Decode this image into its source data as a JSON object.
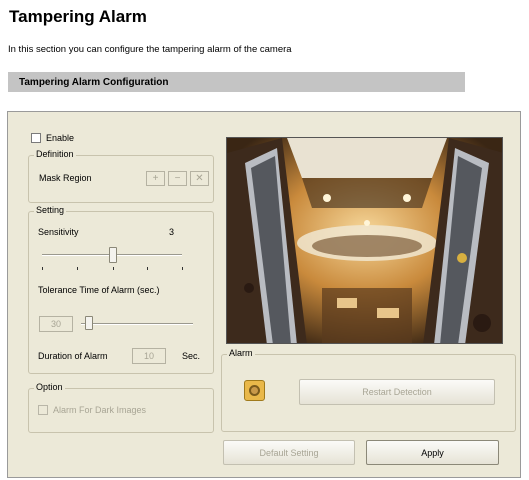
{
  "page": {
    "title": "Tampering Alarm",
    "description": "In this section you can configure the tampering alarm of the camera",
    "section_header": "Tampering Alarm Configuration"
  },
  "enable": {
    "label": "Enable",
    "checked": false
  },
  "definition": {
    "legend": "Definition",
    "mask_region_label": "Mask Region",
    "tools": [
      "add-mask-icon",
      "remove-mask-icon",
      "clear-mask-icon"
    ]
  },
  "setting": {
    "legend": "Setting",
    "sensitivity_label": "Sensitivity",
    "sensitivity_value": "3",
    "tolerance_label": "Tolerance Time of Alarm (sec.)",
    "tolerance_value": "30",
    "duration_label": "Duration of Alarm",
    "duration_value": "10",
    "duration_unit": "Sec."
  },
  "option": {
    "legend": "Option",
    "dark_images_label": "Alarm For Dark Images",
    "dark_images_checked": false
  },
  "alarm": {
    "legend": "Alarm",
    "indicator_icon": "alarm-indicator-icon",
    "restart_label": "Restart Detection"
  },
  "buttons": {
    "default_setting": "Default Setting",
    "apply": "Apply"
  }
}
